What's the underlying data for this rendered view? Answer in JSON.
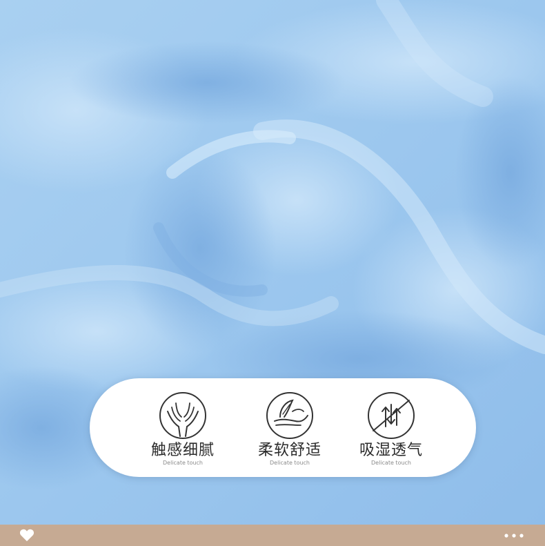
{
  "image": {
    "subject": "light-blue-fabric-closeup",
    "colors": {
      "fabric_base": "#9dc7ee",
      "fabric_highlight": "#c2def7",
      "fabric_shadow": "#7fb1e3",
      "bar": "#c6aa93",
      "pill": "#ffffff"
    }
  },
  "features": [
    {
      "icon": "hands-icon",
      "title": "触感细腻",
      "subtitle": "Delicate touch"
    },
    {
      "icon": "feather-hand-icon",
      "title": "柔软舒适",
      "subtitle": "Delicate touch"
    },
    {
      "icon": "breathable-arrows-icon",
      "title": "吸湿透气",
      "subtitle": "Delicate touch"
    }
  ],
  "bottom_bar": {
    "like_icon": "heart-icon",
    "more_icon": "more-dots-icon"
  }
}
